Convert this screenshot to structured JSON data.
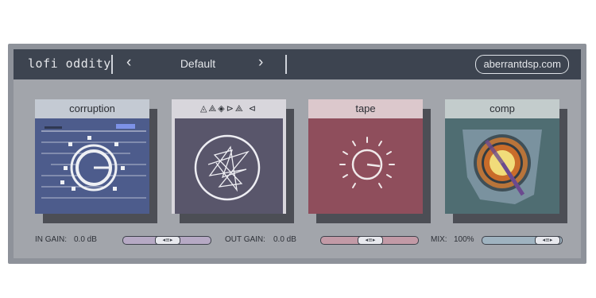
{
  "header": {
    "title": "lofi oddity",
    "prev_icon": "chevron-left-icon",
    "preset_name": "Default",
    "next_icon": "chevron-right-icon",
    "brand": "aberrantdsp.com"
  },
  "modules": [
    {
      "label": "corruption",
      "header_color": "#c4cad3",
      "face_color": "#4d5c8c"
    },
    {
      "label": "◬⟁◈⊳⟁ ⊲",
      "header_color": "#d8d6dc",
      "face_color": "#59566b"
    },
    {
      "label": "tape",
      "header_color": "#dcc8cc",
      "face_color": "#8f4e5c"
    },
    {
      "label": "comp",
      "header_color": "#c3cccc",
      "face_color": "#4f6d72"
    }
  ],
  "controls": {
    "in_gain_label": "IN GAIN:",
    "in_gain_value": "0.0 dB",
    "out_gain_label": "OUT GAIN:",
    "out_gain_value": "0.0 dB",
    "mix_label": "MIX:",
    "mix_value": "100%",
    "thumb_glyph": "◂≡▸"
  }
}
